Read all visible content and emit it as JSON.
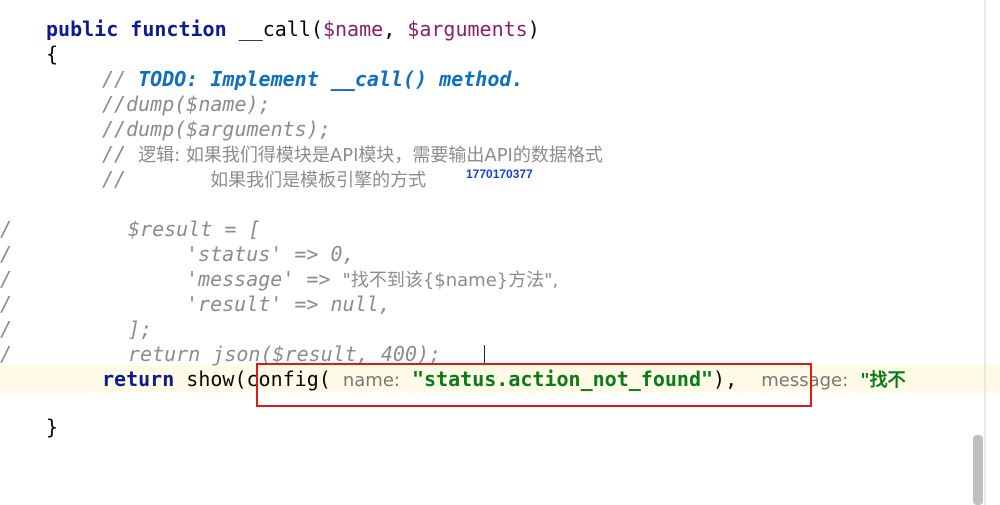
{
  "code": {
    "l1_kw1": "public",
    "l1_kw2": "function",
    "l1_name": "__call(",
    "l1_var1": "$name",
    "l1_sep": ", ",
    "l1_var2": "$arguments",
    "l1_close": ")",
    "l2": "{",
    "l3_prefix": "// ",
    "l3_todo": "TODO: Implement __call() method.",
    "l4": "//dump($name);",
    "l5": "//dump($arguments);",
    "l6_prefix": "// ",
    "l6_text": "逻辑: 如果我们得模块是API模块，需要输出API的数据格式",
    "l7_prefix": "//",
    "l7_text": "如果我们是模板引擎的方式",
    "l8": "$result = [",
    "l9_key": "'status'",
    "l9_arrow": " => ",
    "l9_val": "0,",
    "l10_key": "'message'",
    "l10_arrow": " => ",
    "l10_val": "\"找不到该{$name}方法\",",
    "l11_key": "'result'",
    "l11_arrow": " => ",
    "l11_val": "null,",
    "l12": "];",
    "l13": "return json($result, 400);",
    "l14_kw": "return",
    "l14_call": "show(config(",
    "l14_hint1": "name:",
    "l14_str1": "\"status.action_not_found\"",
    "l14_after": "),",
    "l14_hint2": "message:",
    "l14_str2": "\"找不",
    "l15": "}"
  },
  "gutter_marks": [
    "/",
    "/",
    "/",
    "/",
    "/",
    "/",
    "/"
  ],
  "watermark": "1770170377"
}
